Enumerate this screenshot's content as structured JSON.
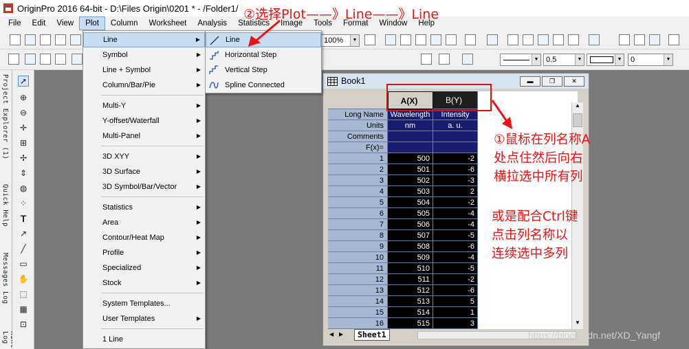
{
  "app": {
    "title": "OriginPro 2016 64-bit - D:\\Files Origin\\0201 * - /Folder1/"
  },
  "menubar": [
    "File",
    "Edit",
    "View",
    "Plot",
    "Column",
    "Worksheet",
    "Analysis",
    "Statistics",
    "Image",
    "Tools",
    "Format",
    "Window",
    "Help"
  ],
  "toolbar": {
    "zoom": "100%",
    "line_width": "0.5",
    "angle": "0"
  },
  "side_tabs": [
    "Project Explorer (1)",
    "Quick Help",
    "Messages Log",
    "Smart Hint Log"
  ],
  "plot_menu": [
    {
      "label": "Line",
      "submenu": true,
      "highlighted": true
    },
    {
      "label": "Symbol",
      "submenu": true
    },
    {
      "label": "Line + Symbol",
      "submenu": true
    },
    {
      "label": "Column/Bar/Pie",
      "submenu": true
    },
    {
      "label": "Multi-Y",
      "submenu": true
    },
    {
      "label": "Y-offset/Waterfall",
      "submenu": true
    },
    {
      "label": "Multi-Panel",
      "submenu": true
    },
    {
      "label": "3D XYY",
      "submenu": true
    },
    {
      "label": "3D Surface",
      "submenu": true
    },
    {
      "label": "3D Symbol/Bar/Vector",
      "submenu": true
    },
    {
      "label": "Statistics",
      "submenu": true
    },
    {
      "label": "Area",
      "submenu": true
    },
    {
      "label": "Contour/Heat Map",
      "submenu": true
    },
    {
      "label": "Profile",
      "submenu": true
    },
    {
      "label": "Specialized",
      "submenu": true
    },
    {
      "label": "Stock",
      "submenu": true
    },
    {
      "label": "System Templates...",
      "submenu": false
    },
    {
      "label": "User Templates",
      "submenu": true
    },
    {
      "label": "1 Line",
      "submenu": false
    }
  ],
  "line_submenu": [
    {
      "label": "Line",
      "icon": "line-icon",
      "highlighted": true
    },
    {
      "label": "Horizontal Step",
      "icon": "horizontal-step-icon"
    },
    {
      "label": "Vertical Step",
      "icon": "vertical-step-icon"
    },
    {
      "label": "Spline Connected",
      "icon": "spline-icon"
    }
  ],
  "book": {
    "title": "Book1",
    "columns": [
      {
        "header": "A(X)"
      },
      {
        "header": "B(Y)"
      }
    ],
    "meta_rows": [
      {
        "label": "Long Name",
        "a": "Wavelength",
        "b": "Intensity"
      },
      {
        "label": "Units",
        "a": "nm",
        "b": "a. u."
      },
      {
        "label": "Comments",
        "a": "",
        "b": ""
      },
      {
        "label": "F(x)=",
        "a": "",
        "b": ""
      }
    ],
    "rows": [
      {
        "n": "1",
        "a": "500",
        "b": "-2"
      },
      {
        "n": "2",
        "a": "501",
        "b": "-6"
      },
      {
        "n": "3",
        "a": "502",
        "b": "-3"
      },
      {
        "n": "4",
        "a": "503",
        "b": "2"
      },
      {
        "n": "5",
        "a": "504",
        "b": "-2"
      },
      {
        "n": "6",
        "a": "505",
        "b": "-4"
      },
      {
        "n": "7",
        "a": "506",
        "b": "-4"
      },
      {
        "n": "8",
        "a": "507",
        "b": "-5"
      },
      {
        "n": "9",
        "a": "508",
        "b": "-6"
      },
      {
        "n": "10",
        "a": "509",
        "b": "-4"
      },
      {
        "n": "11",
        "a": "510",
        "b": "-5"
      },
      {
        "n": "12",
        "a": "511",
        "b": "-2"
      },
      {
        "n": "13",
        "a": "512",
        "b": "-6"
      },
      {
        "n": "14",
        "a": "513",
        "b": "5"
      },
      {
        "n": "15",
        "a": "514",
        "b": "1"
      },
      {
        "n": "16",
        "a": "515",
        "b": "3"
      }
    ],
    "sheet_tab": "Sheet1"
  },
  "annotations": {
    "step2": "②选择Plot——》Line——》Line",
    "step1_lines": [
      "①鼠标在列名称A",
      "处点住然后向右",
      "横拉选中所有列"
    ],
    "alt_lines": [
      "或是配合Ctrl键",
      "点击列名称以",
      "连续选中多列"
    ]
  },
  "watermark": "https://blog.csdn.net/XD_Yangf",
  "colors": {
    "annotation": "#ee1111",
    "selection": "#1a1a6e",
    "menu_highlight": "#c8dcf2"
  }
}
